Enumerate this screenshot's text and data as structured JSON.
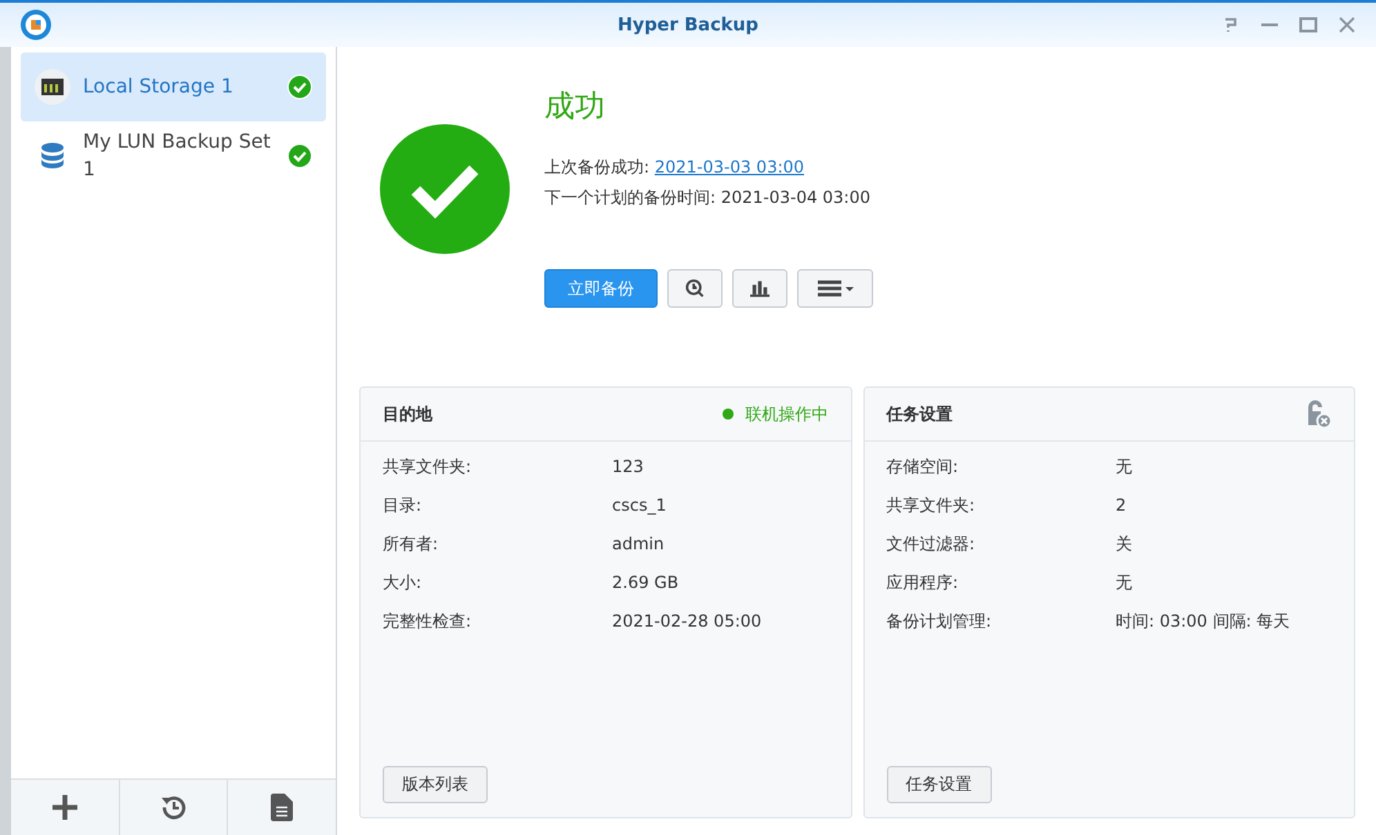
{
  "window": {
    "title": "Hyper Backup"
  },
  "sidebar": {
    "items": [
      {
        "label": "Local Storage 1",
        "kind": "storage",
        "selected": true
      },
      {
        "label": "My LUN Backup Set 1",
        "kind": "database",
        "selected": false
      }
    ]
  },
  "status": {
    "title": "成功",
    "last_label": "上次备份成功:",
    "last_link": "2021-03-03 03:00",
    "next_text": "下一个计划的备份时间: 2021-03-04 03:00"
  },
  "actions": {
    "primary": "立即备份"
  },
  "panels": [
    {
      "title": "目的地",
      "state": {
        "text": "联机操作中",
        "color": "#2fa814"
      },
      "rows": [
        {
          "label": "共享文件夹:",
          "value": "123"
        },
        {
          "label": "目录:",
          "value": "cscs_1"
        },
        {
          "label": "所有者:",
          "value": "admin"
        },
        {
          "label": "大小:",
          "value": "2.69 GB"
        },
        {
          "label": "完整性检查:",
          "value": "2021-02-28 05:00"
        }
      ],
      "button": "版本列表"
    },
    {
      "title": "任务设置",
      "rows": [
        {
          "label": "存储空间:",
          "value": "无"
        },
        {
          "label": "共享文件夹:",
          "value": "2"
        },
        {
          "label": "文件过滤器:",
          "value": "关"
        },
        {
          "label": "应用程序:",
          "value": "无"
        },
        {
          "label": "备份计划管理:",
          "value": "时间: 03:00 间隔: 每天"
        }
      ],
      "button": "任务设置"
    }
  ]
}
